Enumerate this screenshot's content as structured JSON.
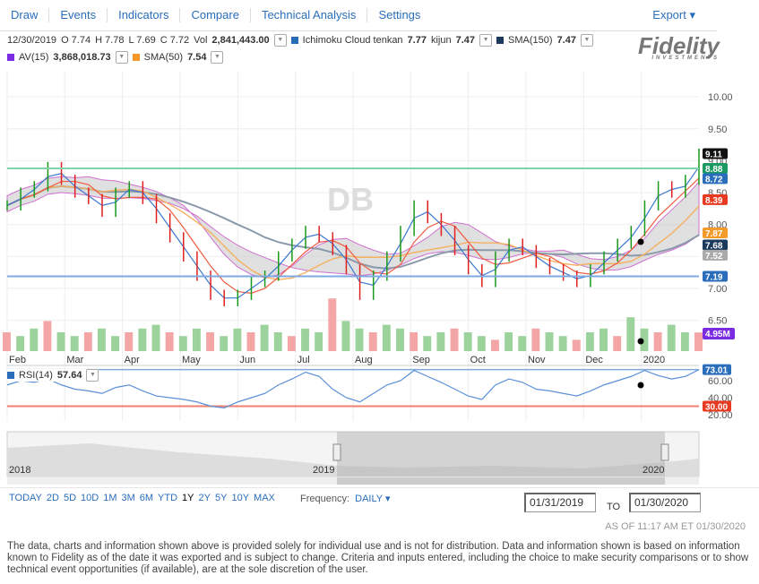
{
  "menu": {
    "items": [
      "Draw",
      "Events",
      "Indicators",
      "Compare",
      "Technical Analysis",
      "Settings"
    ],
    "export": "Export ▾"
  },
  "quote": {
    "date": "12/30/2019",
    "open": "O 7.74",
    "high": "H 7.78",
    "low": "L 7.69",
    "close": "C 7.72",
    "vol_label": "Vol",
    "vol": "2,841,443.00"
  },
  "indicators": {
    "ichimoku_label": "Ichimoku Cloud tenkan",
    "tenkan": "7.77",
    "kijun_label": "kijun",
    "kijun": "7.47",
    "sma150_label": "SMA(150)",
    "sma150": "7.47",
    "av_label": "AV(15)",
    "av": "3,868,018.73",
    "sma50_label": "SMA(50)",
    "sma50": "7.54",
    "rsi_label": "RSI(14)",
    "rsi": "57.64"
  },
  "colors": {
    "ichimoku": "#2a6ebb",
    "sma150": "#1b3a5c",
    "av": "#7b2be2",
    "sma50": "#f39a2b",
    "link": "#2a6ebb"
  },
  "logo": {
    "name": "Fidelity",
    "sub": "INVESTMENTS"
  },
  "chart_data": {
    "type": "line",
    "symbol": "DB",
    "yticks": [
      "10.00",
      "9.50",
      "9.00",
      "8.50",
      "8.00",
      "7.50",
      "7.00",
      "6.50"
    ],
    "months": [
      "Feb",
      "Mar",
      "Apr",
      "May",
      "Jun",
      "Jul",
      "Aug",
      "Sep",
      "Oct",
      "Nov",
      "Dec",
      "2020"
    ],
    "close": [
      8.3,
      8.5,
      8.6,
      8.9,
      8.7,
      8.5,
      8.4,
      8.2,
      8.5,
      8.6,
      8.4,
      8.1,
      7.8,
      7.5,
      7.2,
      6.9,
      6.8,
      6.9,
      7.1,
      7.2,
      7.5,
      7.7,
      7.9,
      7.8,
      7.6,
      7.3,
      6.9,
      7.2,
      7.5,
      7.9,
      8.3,
      8.1,
      7.9,
      7.6,
      7.3,
      7.1,
      7.5,
      7.7,
      7.6,
      7.4,
      7.3,
      7.2,
      7.1,
      7.3,
      7.5,
      7.7,
      7.9,
      8.3,
      8.6,
      8.5,
      8.7,
      9.11
    ],
    "volume_m": [
      5,
      4,
      6,
      8,
      5,
      4,
      5,
      6,
      4,
      5,
      6,
      7,
      5,
      4,
      6,
      5,
      4,
      6,
      5,
      7,
      5,
      4,
      6,
      5,
      14,
      8,
      6,
      5,
      7,
      6,
      5,
      4,
      5,
      6,
      5,
      4,
      3,
      5,
      4,
      6,
      5,
      4,
      3,
      5,
      6,
      4,
      9,
      6,
      5,
      7,
      5,
      4.95
    ],
    "rsi": [
      55,
      60,
      58,
      62,
      55,
      50,
      48,
      45,
      52,
      55,
      48,
      42,
      40,
      38,
      35,
      30,
      28,
      35,
      40,
      45,
      55,
      62,
      70,
      65,
      50,
      40,
      35,
      45,
      55,
      60,
      72,
      65,
      58,
      50,
      42,
      38,
      55,
      62,
      58,
      50,
      48,
      45,
      42,
      48,
      55,
      60,
      65,
      72,
      66,
      62,
      65,
      73.01
    ],
    "labels": {
      "last": "9.11",
      "line_green": "8.88",
      "tenkan": "8.72",
      "kijun_red": "8.39",
      "sma50": "7.87",
      "sma150": "7.68",
      "cloud": "7.52",
      "line_blue": "7.19",
      "av": "4.95M",
      "rsi": "73.01",
      "rsi_low": "30.00"
    },
    "rsi_ticks": [
      "60.00",
      "40.00",
      "20.00"
    ]
  },
  "navigator": {
    "years": [
      "2018",
      "2019",
      "2020"
    ]
  },
  "ranges": [
    "TODAY",
    "2D",
    "5D",
    "10D",
    "1M",
    "3M",
    "6M",
    "YTD",
    "1Y",
    "2Y",
    "5Y",
    "10Y",
    "MAX"
  ],
  "selected_range": "1Y",
  "frequency": {
    "label": "Frequency:",
    "value": "DAILY"
  },
  "dates": {
    "from": "01/31/2019",
    "to_label": "TO",
    "to": "01/30/2020"
  },
  "asof": "AS OF 11:17 AM ET 01/30/2020",
  "disclaimer": "The data, charts and information shown above is provided solely for individual use and is not for distribution. Data and information shown is based on information known to Fidelity as of the date it was exported and is subject to change. Criteria and inputs entered, including the choice to make security comparisons or to show technical event opportunities (if available), are at the sole discretion of the user."
}
